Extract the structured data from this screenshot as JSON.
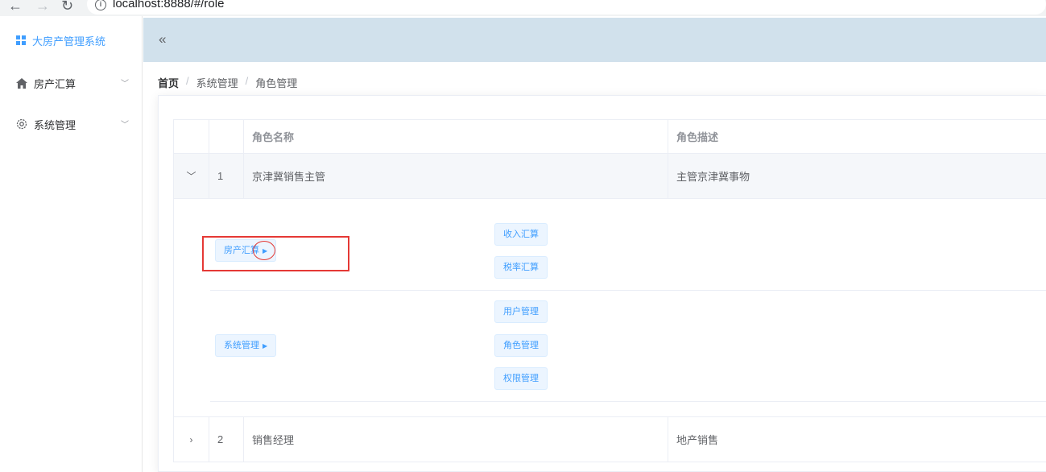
{
  "browser": {
    "url": "localhost:8888/#/role",
    "info_icon_glyph": "i"
  },
  "sidebar": {
    "logo_text": "大房产管理系统",
    "items": [
      {
        "label": "房产汇算",
        "icon": "home-icon"
      },
      {
        "label": "系统管理",
        "icon": "gear-icon"
      }
    ]
  },
  "breadcrumb": [
    "首页",
    "系统管理",
    "角色管理"
  ],
  "table": {
    "headers": [
      "",
      "",
      "角色名称",
      "角色描述"
    ],
    "rows": [
      {
        "index": "1",
        "name": "京津冀销售主管",
        "desc": "主管京津冀事物",
        "expanded": true
      },
      {
        "index": "2",
        "name": "销售经理",
        "desc": "地产销售",
        "expanded": false
      }
    ],
    "expanded_permissions": [
      {
        "level1": "房产汇算",
        "children": [
          "收入汇算",
          "税率汇算"
        ]
      },
      {
        "level1": "系统管理",
        "children": [
          "用户管理",
          "角色管理",
          "权限管理"
        ]
      }
    ]
  },
  "colors": {
    "accent": "#409eff",
    "header_bg": "#d1e1ec",
    "annotation": "#e53935"
  }
}
